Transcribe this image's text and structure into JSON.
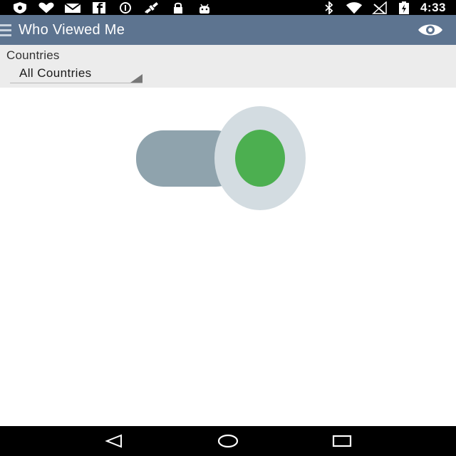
{
  "status_bar": {
    "time": "4:33",
    "left_icons": [
      "shield-icon",
      "heart-icon",
      "mail-icon",
      "facebook-icon",
      "info-icon",
      "satellite-icon",
      "lock-icon",
      "android-icon"
    ],
    "right_icons": [
      "bluetooth-icon",
      "wifi-icon",
      "no-signal-icon",
      "battery-icon"
    ]
  },
  "app_bar": {
    "title": "Who Viewed Me",
    "menu_icon": "menu-icon",
    "action_icon": "eye-icon",
    "background_color": "#5d7490"
  },
  "filter": {
    "label": "Countries",
    "selected": "All Countries"
  },
  "illustration": {
    "icon": "toggle-switch-icon",
    "state": "on",
    "accent_color": "#4caf50"
  },
  "nav_bar": {
    "buttons": [
      "back-icon",
      "home-icon",
      "recents-icon"
    ]
  }
}
